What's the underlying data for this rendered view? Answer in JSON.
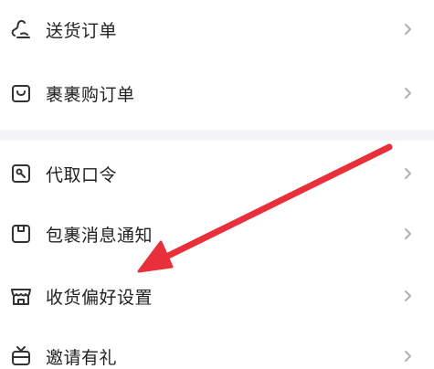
{
  "section1": {
    "items": [
      {
        "label": "送货订单",
        "icon": "delivery-order-icon"
      },
      {
        "label": "裹裹购订单",
        "icon": "shopping-bag-icon"
      }
    ]
  },
  "section2": {
    "items": [
      {
        "label": "代取口令",
        "icon": "pickup-code-icon"
      },
      {
        "label": "包裹消息通知",
        "icon": "package-notification-icon"
      },
      {
        "label": "收货偏好设置",
        "icon": "storefront-icon"
      },
      {
        "label": "邀请有礼",
        "icon": "gift-tv-icon"
      }
    ]
  },
  "annotation": {
    "arrow_color": "#e8303a",
    "points_to": "收货偏好设置"
  },
  "colors": {
    "icon": "#333333",
    "chevron": "#b0b0b0",
    "separator": "#f4f4f6"
  }
}
